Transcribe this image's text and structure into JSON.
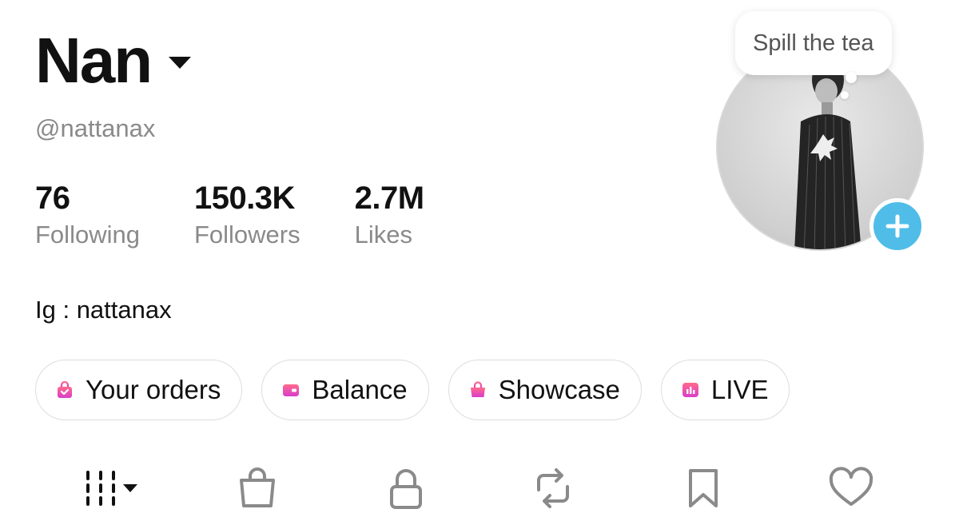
{
  "profile": {
    "display_name": "Nan",
    "username": "@nattanax",
    "bio": "Ig : nattanax",
    "bubble_text": "Spill the tea"
  },
  "stats": [
    {
      "value": "76",
      "label": "Following"
    },
    {
      "value": "150.3K",
      "label": "Followers"
    },
    {
      "value": "2.7M",
      "label": "Likes"
    }
  ],
  "pills": [
    {
      "label": "Your orders",
      "icon": "bag-check-icon"
    },
    {
      "label": "Balance",
      "icon": "wallet-icon"
    },
    {
      "label": "Showcase",
      "icon": "shopping-bag-icon"
    },
    {
      "label": "LIVE",
      "icon": "live-chart-icon"
    }
  ],
  "tabs": [
    {
      "icon": "grid-videos-icon"
    },
    {
      "icon": "shopping-bag-icon"
    },
    {
      "icon": "lock-icon"
    },
    {
      "icon": "repost-icon"
    },
    {
      "icon": "bookmark-icon"
    },
    {
      "icon": "heart-icon"
    }
  ],
  "colors": {
    "accent_blue": "#4fbde8",
    "pill_gradient_start": "#ff6b8a",
    "pill_gradient_end": "#d93ccc",
    "muted_text": "#8a8a8a"
  }
}
